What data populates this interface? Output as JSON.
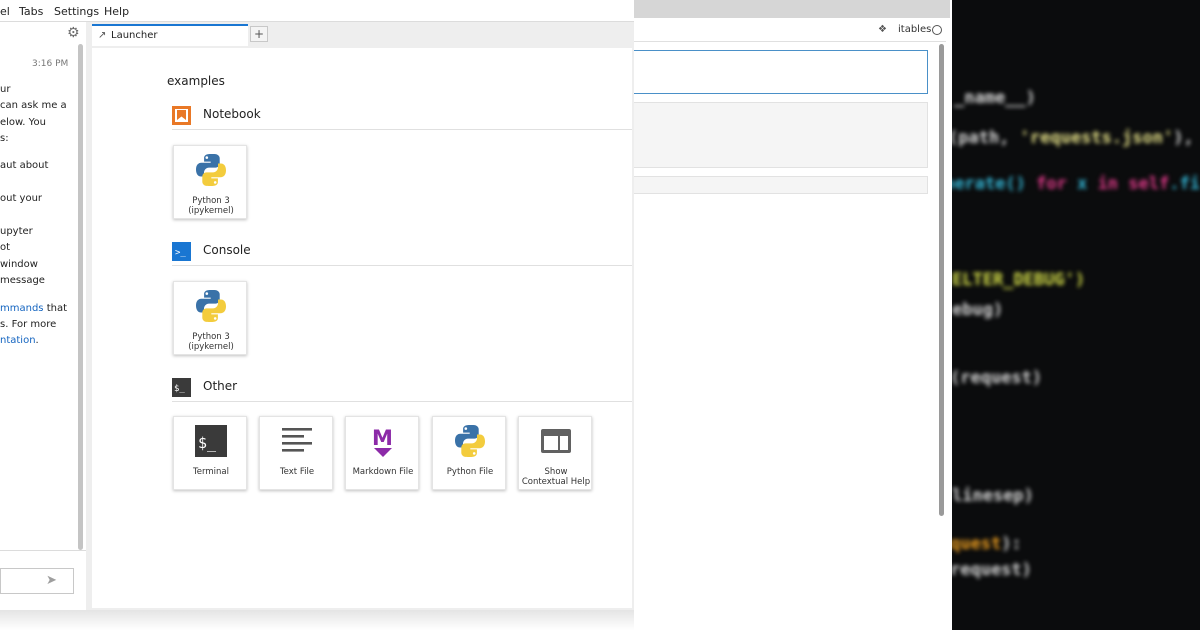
{
  "menubar": {
    "items": [
      "el",
      "Tabs",
      "Settings",
      "Help"
    ]
  },
  "chat": {
    "time": "3:16 PM",
    "lines": [
      "ur",
      "can ask me a",
      "elow. You",
      "s:",
      "aut about",
      "out your",
      "upyter",
      "ot",
      "window",
      "message"
    ],
    "commands_link": "mmands",
    "commands_rest": " that",
    "for_more": "s. For more",
    "docs_link": "ntation",
    "docs_rest": "."
  },
  "tab": {
    "label": "Launcher",
    "add": "+"
  },
  "launcher": {
    "cwd": "examples",
    "sections": [
      {
        "title": "Notebook",
        "cards": [
          {
            "line1": "Python 3",
            "line2": "(ipykernel)"
          }
        ]
      },
      {
        "title": "Console",
        "cards": [
          {
            "line1": "Python 3",
            "line2": "(ipykernel)"
          }
        ]
      },
      {
        "title": "Other",
        "cards": [
          {
            "line1": "Terminal",
            "line2": ""
          },
          {
            "line1": "Text File",
            "line2": ""
          },
          {
            "line1": "Markdown File",
            "line2": ""
          },
          {
            "line1": "Python File",
            "line2": ""
          },
          {
            "line1": "Show",
            "line2": "Contextual Help"
          }
        ]
      }
    ],
    "icon_glyphs": {
      "terminal": "$_",
      "console": ">_",
      "markdown": "M"
    }
  },
  "back_window": {
    "toolbar_text": "itables"
  },
  "colors": {
    "accent": "#1976d2",
    "notebook_icon": "#e97826",
    "console_icon": "#1976d2",
    "markdown_icon": "#8c2aa8",
    "python_blue": "#3a72a8",
    "python_yellow": "#f3cc3d"
  }
}
